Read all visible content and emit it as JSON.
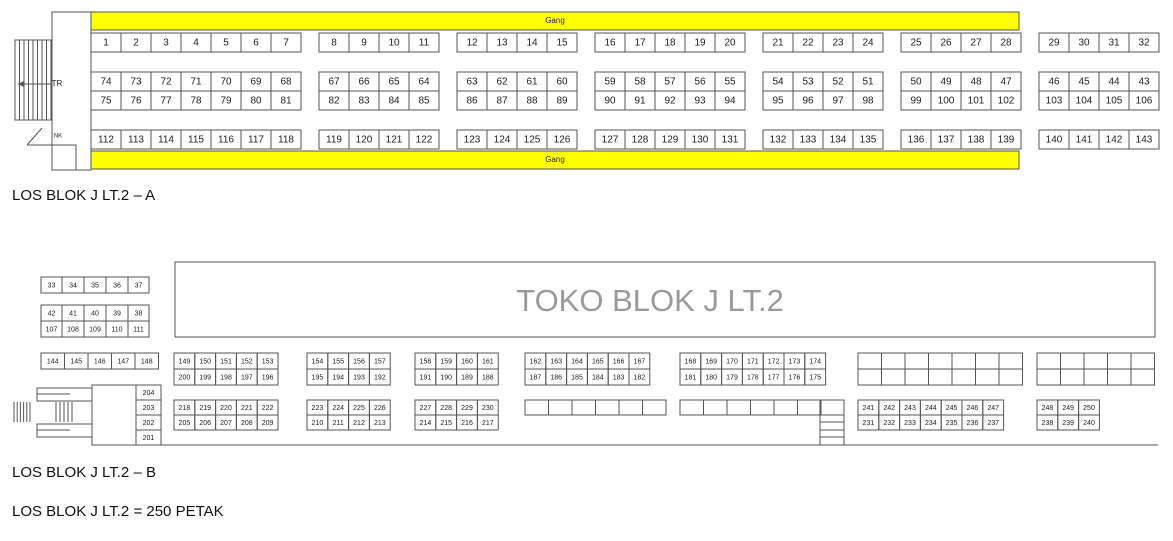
{
  "section_a": {
    "gang_label": "Gang",
    "tr_label": "TR",
    "nk_label": "NK",
    "row_top": [
      [
        1,
        2,
        3,
        4,
        5,
        6,
        7
      ],
      [
        8,
        9,
        10,
        11
      ],
      [
        12,
        13,
        14,
        15
      ],
      [
        16,
        17,
        18,
        19,
        20
      ],
      [
        21,
        22,
        23,
        24
      ],
      [
        25,
        26,
        27,
        28
      ],
      [
        29,
        30,
        31,
        32
      ]
    ],
    "row_mid_upper": [
      [
        74,
        73,
        72,
        71,
        70,
        69,
        68
      ],
      [
        67,
        66,
        65,
        64
      ],
      [
        63,
        62,
        61,
        60
      ],
      [
        59,
        58,
        57,
        56,
        55
      ],
      [
        54,
        53,
        52,
        51
      ],
      [
        50,
        49,
        48,
        47
      ],
      [
        46,
        45,
        44,
        43
      ]
    ],
    "row_mid_lower": [
      [
        75,
        76,
        77,
        78,
        79,
        80,
        81
      ],
      [
        82,
        83,
        84,
        85
      ],
      [
        86,
        87,
        88,
        89
      ],
      [
        90,
        91,
        92,
        93,
        94
      ],
      [
        95,
        96,
        97,
        98
      ],
      [
        99,
        100,
        101,
        102
      ],
      [
        103,
        104,
        105,
        106
      ]
    ],
    "row_bottom": [
      [
        112,
        113,
        114,
        115,
        116,
        117,
        118
      ],
      [
        119,
        120,
        121,
        122
      ],
      [
        123,
        124,
        125,
        126
      ],
      [
        127,
        128,
        129,
        130,
        131
      ],
      [
        132,
        133,
        134,
        135
      ],
      [
        136,
        137,
        138,
        139
      ],
      [
        140,
        141,
        142,
        143
      ]
    ],
    "caption": "LOS BLOK J LT.2 – A"
  },
  "section_b": {
    "toko_label": "TOKO BLOK J LT.2",
    "left_block": [
      [
        33,
        34,
        35,
        36,
        37
      ],
      [
        42,
        41,
        40,
        39,
        38
      ],
      [
        107,
        108,
        109,
        110,
        111
      ]
    ],
    "row_144": [
      144,
      145,
      146,
      147,
      148
    ],
    "upper_groups": [
      {
        "top": [
          149,
          150,
          151,
          152,
          153
        ],
        "bottom": [
          200,
          199,
          198,
          197,
          196
        ]
      },
      {
        "top": [
          154,
          155,
          156,
          157
        ],
        "bottom": [
          195,
          194,
          193,
          192
        ]
      },
      {
        "top": [
          158,
          159,
          160,
          161
        ],
        "bottom": [
          191,
          190,
          189,
          188
        ]
      },
      {
        "top": [
          162,
          163,
          164,
          165,
          166,
          167
        ],
        "bottom": [
          187,
          186,
          185,
          184,
          183,
          182
        ]
      },
      {
        "top": [
          168,
          169,
          170,
          171,
          172,
          173,
          174
        ],
        "bottom": [
          181,
          180,
          179,
          178,
          177,
          176,
          175
        ]
      }
    ],
    "stair_col": [
      204,
      203,
      202,
      201
    ],
    "lower_groups": [
      {
        "top": [
          218,
          219,
          220,
          221,
          222
        ],
        "bottom": [
          205,
          206,
          207,
          208,
          209
        ]
      },
      {
        "top": [
          223,
          224,
          225,
          226
        ],
        "bottom": [
          210,
          211,
          212,
          213
        ]
      },
      {
        "top": [
          227,
          228,
          229,
          230
        ],
        "bottom": [
          214,
          215,
          216,
          217
        ]
      }
    ],
    "right_lower_groups": [
      {
        "top": [
          241,
          242,
          243,
          244,
          245,
          246,
          247
        ],
        "bottom": [
          231,
          232,
          233,
          234,
          235,
          236,
          237
        ]
      },
      {
        "top": [
          248,
          249,
          250
        ],
        "bottom": [
          238,
          239,
          240
        ]
      }
    ],
    "caption": "LOS BLOK J LT.2 – B",
    "total_caption": "LOS BLOK J LT.2 = 250 PETAK"
  },
  "colors": {
    "gang": "#ffff00",
    "line": "#555555",
    "toko_text": "#9a9a9a"
  }
}
